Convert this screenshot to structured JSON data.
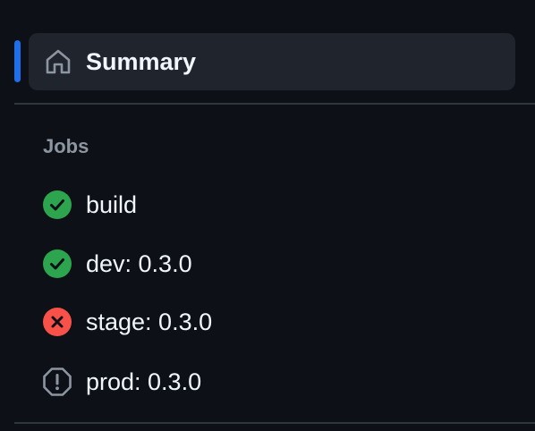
{
  "summary": {
    "label": "Summary",
    "icon": "home-icon"
  },
  "jobs_section": {
    "heading": "Jobs",
    "items": [
      {
        "label": "build",
        "status": "success",
        "icon": "check-circle-fill-icon"
      },
      {
        "label": "dev: 0.3.0",
        "status": "success",
        "icon": "check-circle-fill-icon"
      },
      {
        "label": "stage: 0.3.0",
        "status": "failure",
        "icon": "x-circle-fill-icon"
      },
      {
        "label": "prod: 0.3.0",
        "status": "blocked",
        "icon": "stop-octagon-icon"
      }
    ]
  },
  "colors": {
    "background": "#0d1117",
    "selected_background": "#1f242d",
    "selected_indicator": "#1f6feb",
    "success": "#2da44e",
    "failure": "#f85149",
    "neutral_icon": "#8d96a0",
    "divider": "#30363d"
  }
}
